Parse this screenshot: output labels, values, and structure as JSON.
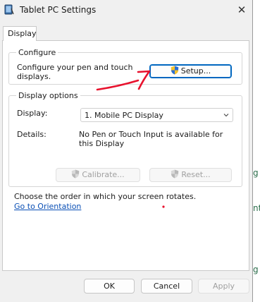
{
  "window": {
    "title": "Tablet PC Settings",
    "close_glyph": "✕"
  },
  "tabs": [
    {
      "label": "Display"
    }
  ],
  "configure": {
    "group_label": "Configure",
    "description": "Configure your pen and touch displays.",
    "setup_button": "Setup..."
  },
  "display_options": {
    "group_label": "Display options",
    "display_label": "Display:",
    "display_value": "1. Mobile PC Display",
    "details_label": "Details:",
    "details_value": "No Pen or Touch Input is available for this Display",
    "calibrate_button": "Calibrate...",
    "reset_button": "Reset..."
  },
  "orientation": {
    "text": "Choose the order in which your screen rotates.",
    "link": "Go to Orientation"
  },
  "footer": {
    "ok": "OK",
    "cancel": "Cancel",
    "apply": "Apply"
  },
  "background_glyphs": [
    "g",
    "nt",
    "g"
  ],
  "colors": {
    "accent": "#0067c0",
    "link": "#0a4fb5",
    "annotation_ink": "#e8112d"
  },
  "icons": {
    "app": "tablet-pc-icon",
    "shield": "uac-shield-icon",
    "dropdown": "chevron-down-icon"
  }
}
